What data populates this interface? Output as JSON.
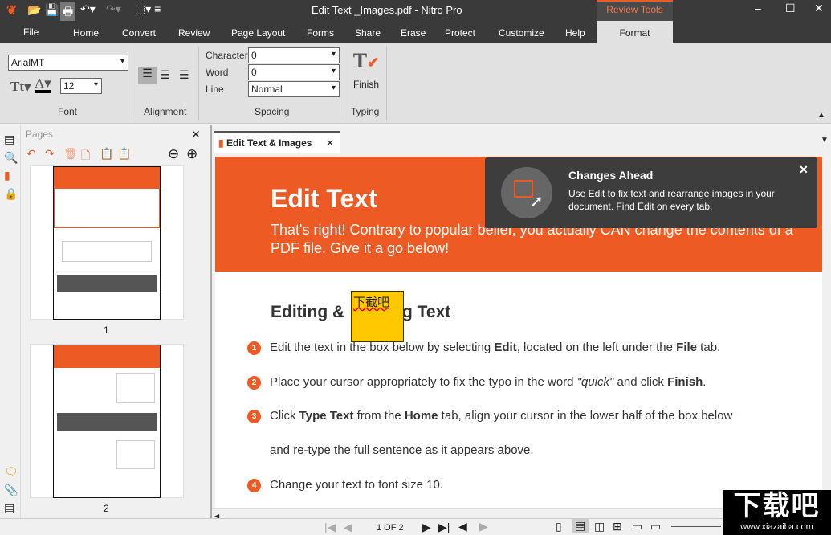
{
  "window": {
    "title": "Edit Text _Images.pdf - Nitro Pro",
    "context_tab": "Review Tools"
  },
  "menu": {
    "file": "File",
    "tabs": [
      "Home",
      "Convert",
      "Review",
      "Page Layout",
      "Forms",
      "Share",
      "Erase",
      "Protect",
      "Customize",
      "Help"
    ],
    "format": "Format"
  },
  "ribbon": {
    "font_name": "ArialMT",
    "font_size": "12",
    "font_group": "Font",
    "alignment_group": "Alignment",
    "character_label": "Character",
    "character_value": "0",
    "word_label": "Word",
    "word_value": "0",
    "line_label": "Line",
    "line_value": "Normal",
    "spacing_group": "Spacing",
    "finish": "Finish",
    "typing_group": "Typing"
  },
  "pages_panel": {
    "title": "Pages",
    "page_labels": [
      "1",
      "2"
    ]
  },
  "doc_tab": {
    "label": "Edit Text & Images"
  },
  "document": {
    "title": "Edit Text",
    "intro": "That's right! Contrary to popular belief, you actually CAN change the contents of a PDF file. Give it a go below!",
    "heading_left": "Editing & ",
    "heading_right": "g Text",
    "overlay_text": "下截吧",
    "steps": [
      {
        "n": "1",
        "html": "Edit the text in the box below by selecting <b>Edit</b>, located on the left under the <b>File</b> tab."
      },
      {
        "n": "2",
        "html": "Place your cursor appropriately to fix the typo in the word <i>\"quick\"</i> and click <b>Finish</b>."
      },
      {
        "n": "3",
        "html": "Click <b>Type Text</b> from the <b>Home</b> tab, align your cursor in the lower half of the box below"
      },
      {
        "n": "",
        "html": "and re-type the full sentence as it appears above."
      },
      {
        "n": "4",
        "html": "Change your text to font size 10."
      }
    ]
  },
  "toast": {
    "title": "Changes Ahead",
    "body": "Use Edit to fix text and rearrange images in your document. Find Edit on every tab."
  },
  "status": {
    "page": "1 OF 2"
  },
  "watermark": {
    "text": "下载吧",
    "url": "www.xiazaiba.com"
  },
  "colors": {
    "accent": "#ee5a24",
    "chrome": "#3a3a3a"
  }
}
